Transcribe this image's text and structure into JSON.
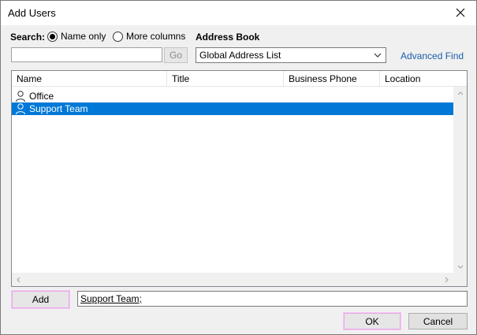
{
  "window": {
    "title": "Add Users",
    "close_icon": "close-icon"
  },
  "search": {
    "label": "Search:",
    "option_name_only": "Name only",
    "option_more_columns": "More columns",
    "selected": "Name only",
    "value": "",
    "go_label": "Go"
  },
  "address_book": {
    "label": "Address Book",
    "selected": "Global Address List",
    "advanced_find": "Advanced Find"
  },
  "list": {
    "columns": [
      "Name",
      "Title",
      "Business Phone",
      "Location"
    ],
    "rows": [
      {
        "name": "Office",
        "selected": false,
        "icon": "user-icon"
      },
      {
        "name": "Support Team",
        "selected": true,
        "icon": "user-icon"
      }
    ]
  },
  "footer": {
    "add_label": "Add",
    "recipients_value": "Support Team;",
    "ok_label": "OK",
    "cancel_label": "Cancel"
  },
  "colors": {
    "selection": "#0078d7",
    "link": "#1a5eab",
    "focus_outline": "#e8a6e8"
  }
}
